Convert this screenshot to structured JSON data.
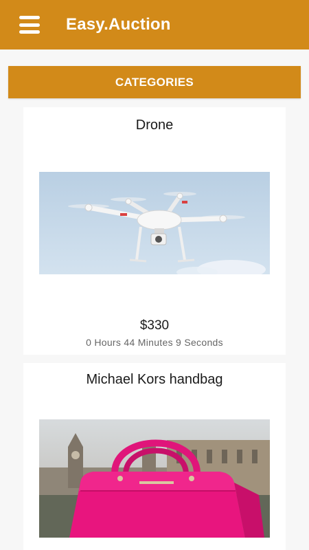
{
  "header": {
    "title": "Easy.Auction",
    "menu_icon": "hamburger-menu-icon",
    "background_color": "#d28a19"
  },
  "categories_button": {
    "label": "CATEGORIES"
  },
  "listings": [
    {
      "title": "Drone",
      "image": "drone-photo",
      "price": "$330",
      "time_remaining": "0 Hours 44 Minutes 9 Seconds"
    },
    {
      "title": "Michael Kors handbag",
      "image": "pink-handbag-photo"
    }
  ]
}
